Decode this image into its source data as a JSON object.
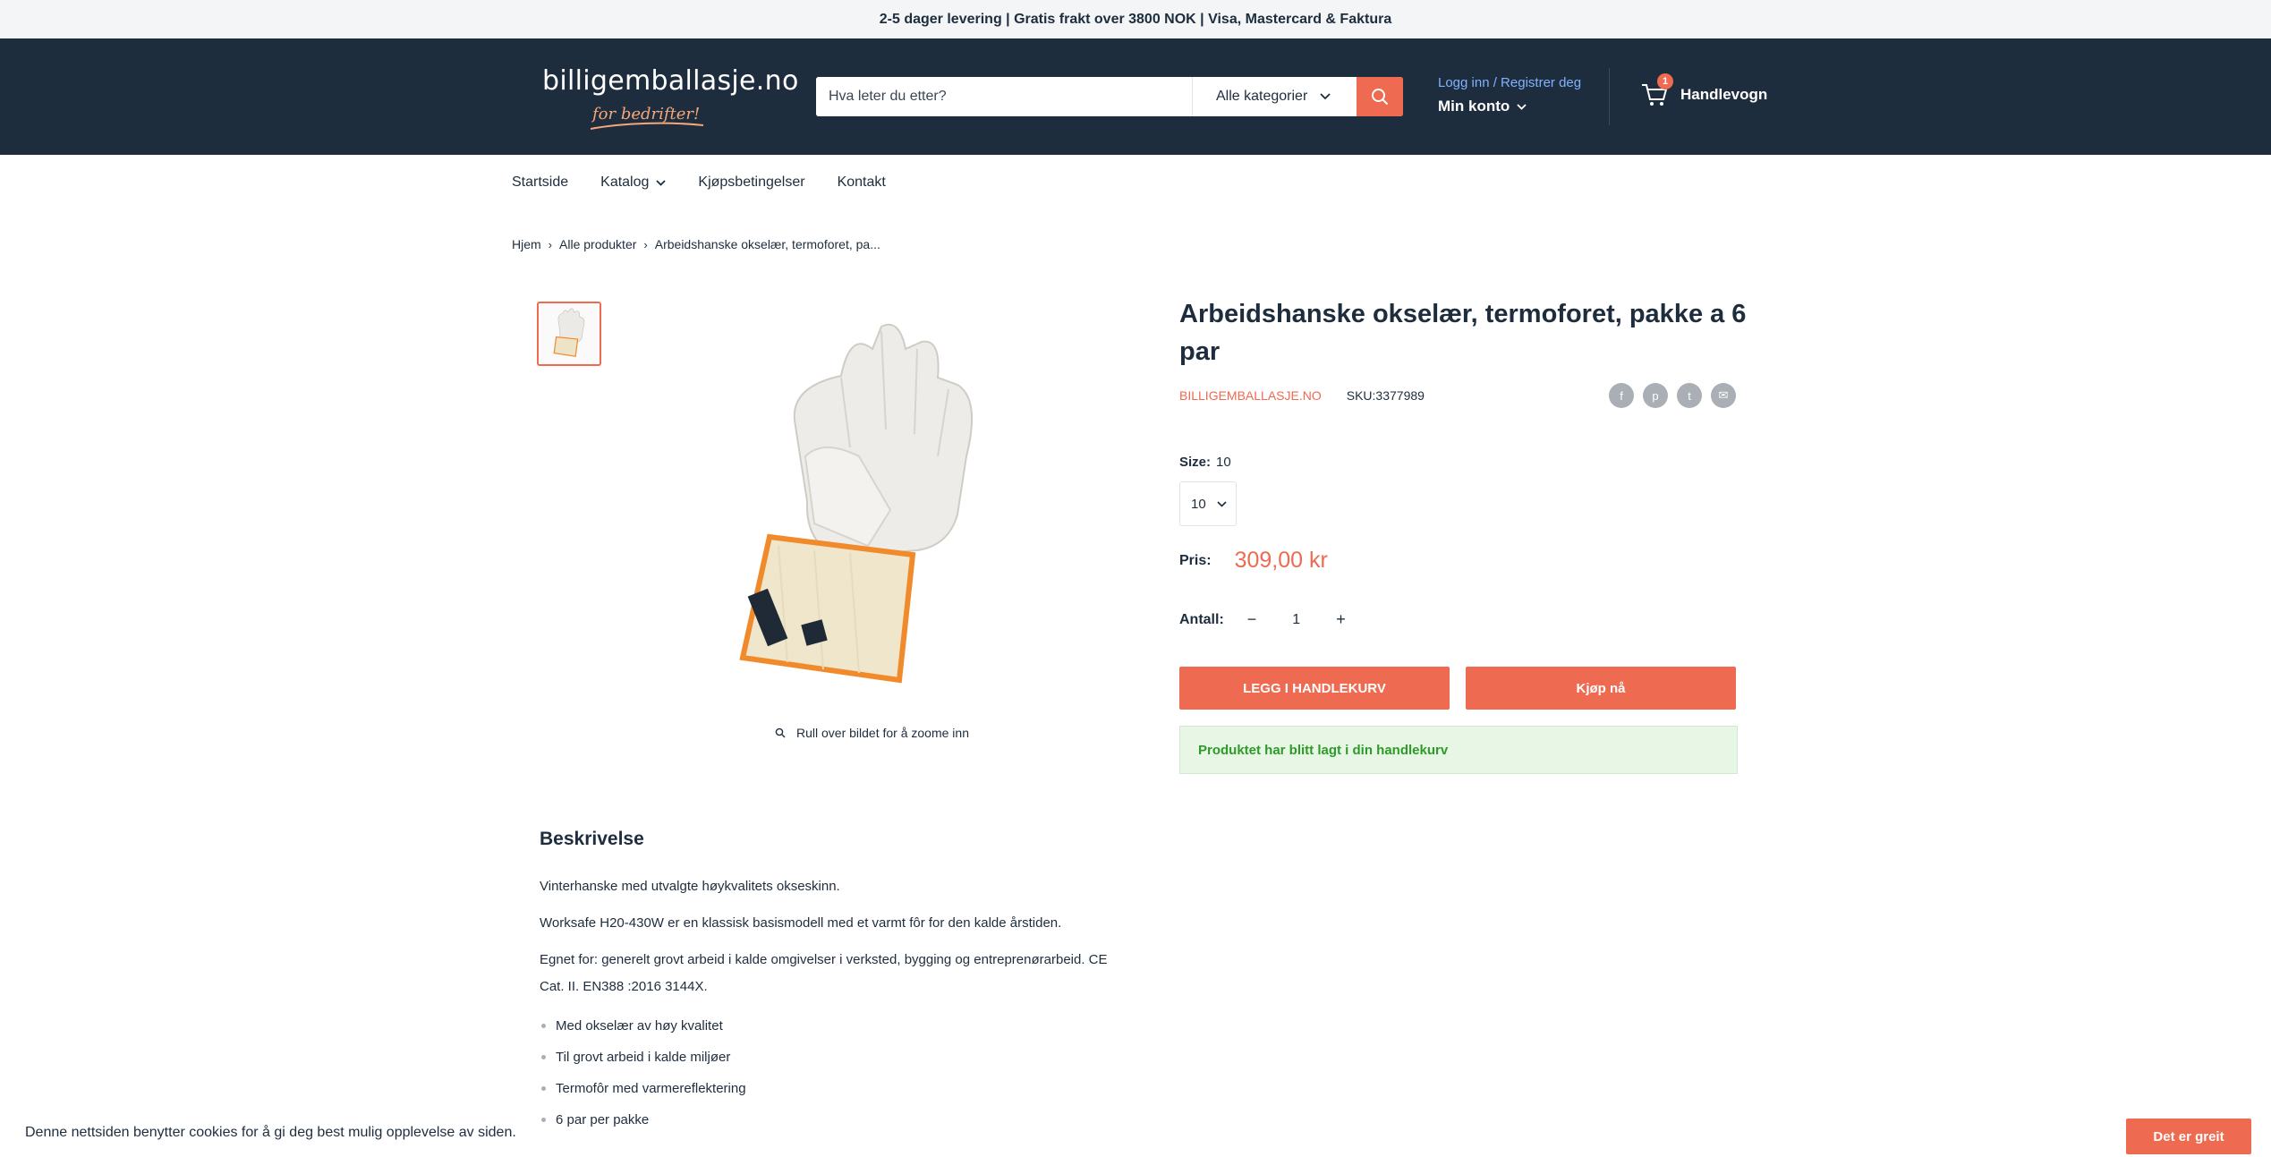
{
  "announcement": "2-5 dager levering | Gratis frakt over 3800 NOK | Visa, Mastercard & Faktura",
  "header": {
    "logo_text": "billigemballasje.no",
    "logo_sub": "for bedrifter!",
    "search_placeholder": "Hva leter du etter?",
    "category_label": "Alle kategorier",
    "login_label": "Logg inn / Registrer deg",
    "account_label": "Min konto",
    "cart_count": "1",
    "cart_label": "Handlevogn"
  },
  "nav": {
    "items": [
      "Startside",
      "Katalog",
      "Kjøpsbetingelser",
      "Kontakt"
    ]
  },
  "breadcrumb": [
    "Hjem",
    "Alle produkter",
    "Arbeidshanske okselær, termoforet, pa..."
  ],
  "product": {
    "title": "Arbeidshanske okselær, termoforet, pakke a 6 par",
    "vendor": "BILLIGEMBALLASJE.NO",
    "sku_label": "SKU:",
    "sku": "3377989",
    "zoom_hint": "Rull over bildet for å zoome inn",
    "size_label": "Size:",
    "size_value": "10",
    "size_selected": "10",
    "price_label": "Pris:",
    "price": "309,00 kr",
    "qty_label": "Antall:",
    "qty_value": "1",
    "add_to_cart": "LEGG I HANDLEKURV",
    "buy_now": "Kjøp nå",
    "added_message": "Produktet har blitt lagt i din handlekurv"
  },
  "share_icons": [
    "facebook-icon",
    "pinterest-icon",
    "twitter-icon",
    "email-icon"
  ],
  "description": {
    "heading": "Beskrivelse",
    "paragraphs": [
      "Vinterhanske med utvalgte høykvalitets okseskinn.",
      "Worksafe H20-430W er en klassisk basismodell med et varmt fôr for den kalde årstiden.",
      "Egnet for: generelt grovt arbeid i kalde omgivelser i verksted, bygging og entreprenørarbeid. CE Cat. II. EN388 :2016 3144X."
    ],
    "bullets": [
      "Med okselær av høy kvalitet",
      "Til grovt arbeid i kalde miljøer",
      "Termofôr med varmereflektering",
      "6 par per pakke"
    ]
  },
  "cookie": {
    "text": "Denne nettsiden benytter cookies for å gi deg best mulig opplevelse av siden.",
    "button": "Det er greit"
  },
  "colors": {
    "header_bg": "#1e2d3d",
    "accent": "#ee6a50",
    "link": "#7fb2ff",
    "success_bg": "#e7f6e5",
    "success_text": "#2e9a28"
  }
}
